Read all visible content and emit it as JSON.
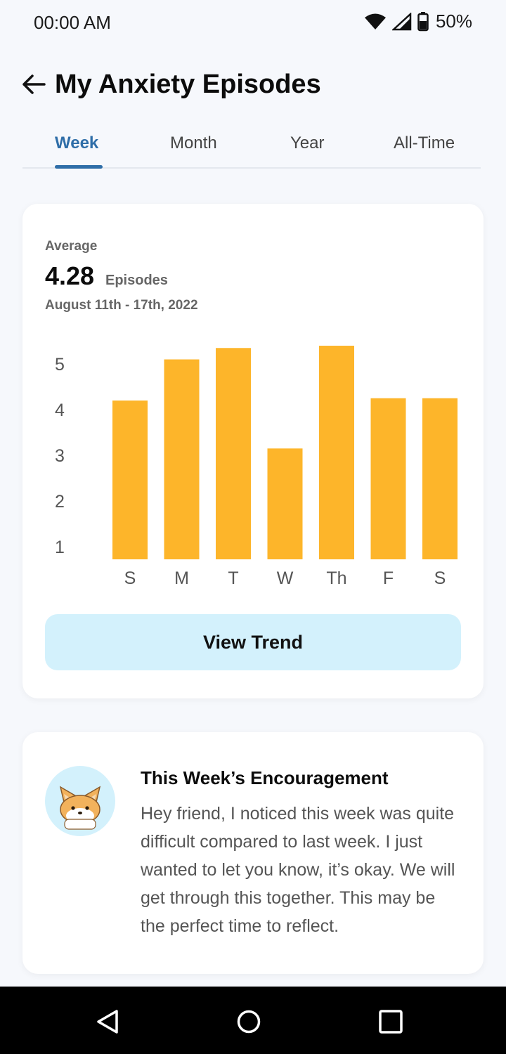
{
  "status_bar": {
    "time": "00:00 AM",
    "battery": "50%",
    "icons": [
      "wifi-icon",
      "signal-icon",
      "battery-icon"
    ]
  },
  "header": {
    "title": "My Anxiety Episodes",
    "back_icon": "arrow-left-icon"
  },
  "tabs": [
    {
      "label": "Week",
      "active": true
    },
    {
      "label": "Month",
      "active": false
    },
    {
      "label": "Year",
      "active": false
    },
    {
      "label": "All-Time",
      "active": false
    }
  ],
  "stats": {
    "average_label": "Average",
    "average_value": "4.28",
    "unit": "Episodes",
    "date_range": "August 11th - 17th, 2022"
  },
  "chart_data": {
    "type": "bar",
    "categories": [
      "S",
      "M",
      "T",
      "W",
      "Th",
      "F",
      "S"
    ],
    "values": [
      4.2,
      5.1,
      5.35,
      3.15,
      5.4,
      4.25,
      4.25
    ],
    "y_ticks": [
      "1",
      "2",
      "3",
      "4",
      "5"
    ],
    "ylim": [
      0.9,
      5.5
    ],
    "bar_color": "#fdb52a",
    "grid": false
  },
  "actions": {
    "view_trend": "View Trend"
  },
  "encouragement": {
    "title": "This Week’s Encouragement",
    "body": "Hey friend, I noticed this week was quite difficult compared to last week. I just wanted to let you know, it’s okay. We will get through this together. This may be the perfect time to reflect.",
    "avatar": "fox-avatar-icon"
  },
  "nav_bar": {
    "buttons": [
      "back-triangle-icon",
      "home-circle-icon",
      "recents-square-icon"
    ]
  },
  "colors": {
    "accent": "#2f6ea8",
    "bar": "#fdb52a",
    "button_bg": "#d3f1fc",
    "background": "#f6f8fc"
  }
}
